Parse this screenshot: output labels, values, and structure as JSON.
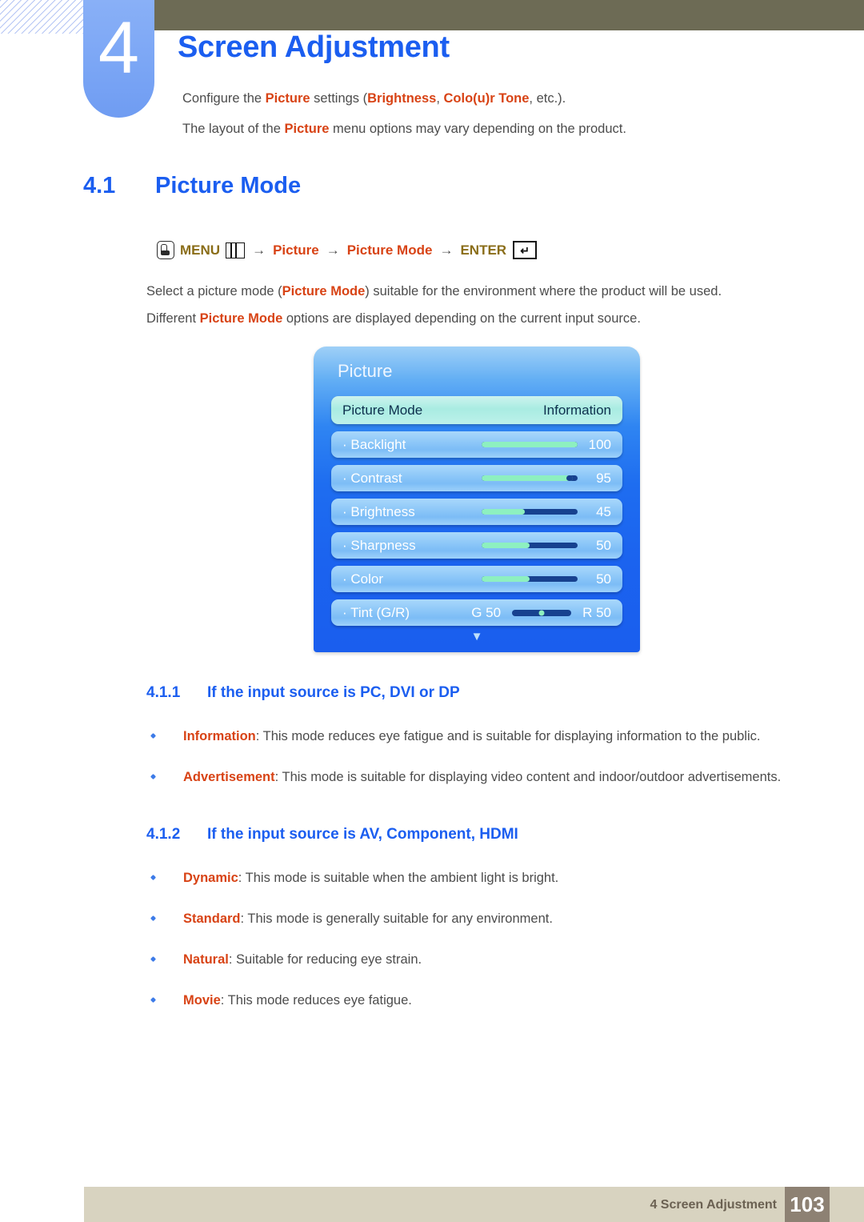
{
  "chapter": {
    "number": "4",
    "title": "Screen Adjustment",
    "lead_line1_pre": "Configure the ",
    "lead_line1_hl1": "Picture",
    "lead_line1_mid": " settings (",
    "lead_line1_hl2": "Brightness",
    "lead_line1_mid2": ", ",
    "lead_line1_hl3": "Colo(u)r Tone",
    "lead_line1_post": ", etc.).",
    "lead_line2_pre": "The layout of the ",
    "lead_line2_hl": "Picture",
    "lead_line2_post": " menu options may vary depending on the product."
  },
  "section": {
    "number": "4.1",
    "title": "Picture Mode"
  },
  "menu_path": {
    "hand_icon": "hand-press-icon",
    "menu_label": "MENU",
    "menu_icon": "menu-bars-icon",
    "arrow": "→",
    "step1": "Picture",
    "step2": "Picture Mode",
    "enter_label": "ENTER",
    "enter_icon": "enter-return-icon"
  },
  "paragraph": {
    "line1_pre": "Select a picture mode (",
    "line1_hl": "Picture Mode",
    "line1_post": ") suitable for the environment where the product will be used.",
    "line2_pre": "Different ",
    "line2_hl": "Picture Mode",
    "line2_post": " options are displayed depending on the current input source."
  },
  "osd": {
    "title": "Picture",
    "down_arrow": "▼",
    "rows": [
      {
        "label": "Picture Mode",
        "value": "Information",
        "selected": true,
        "slider": null
      },
      {
        "label": "· Backlight",
        "value": "100",
        "selected": false,
        "slider": {
          "percent": 100,
          "capped": false
        }
      },
      {
        "label": "· Contrast",
        "value": "95",
        "selected": false,
        "slider": {
          "percent": 95,
          "capped": true
        }
      },
      {
        "label": "· Brightness",
        "value": "45",
        "selected": false,
        "slider": {
          "percent": 45,
          "capped": false
        }
      },
      {
        "label": "· Sharpness",
        "value": "50",
        "selected": false,
        "slider": {
          "percent": 50,
          "capped": false
        }
      },
      {
        "label": "· Color",
        "value": "50",
        "selected": false,
        "slider": {
          "percent": 50,
          "capped": false
        }
      }
    ],
    "tint_row": {
      "label": "· Tint (G/R)",
      "left_value": "G 50",
      "right_value": "R 50"
    }
  },
  "subsection1": {
    "number": "4.1.1",
    "title": "If the input source is PC, DVI or DP",
    "items": [
      {
        "term": "Information",
        "text": ": This mode reduces eye fatigue and is suitable for displaying information to the public."
      },
      {
        "term": "Advertisement",
        "text": ": This mode is suitable for displaying video content and indoor/outdoor advertisements."
      }
    ]
  },
  "subsection2": {
    "number": "4.1.2",
    "title": "If the input source is AV, Component, HDMI",
    "items": [
      {
        "term": "Dynamic",
        "text": ": This mode is suitable when the ambient light is bright."
      },
      {
        "term": "Standard",
        "text": ": This mode is generally suitable for any environment."
      },
      {
        "term": "Natural",
        "text": ": Suitable for reducing eye strain."
      },
      {
        "term": "Movie",
        "text": ": This mode reduces eye fatigue."
      }
    ]
  },
  "footer": {
    "text": "4 Screen Adjustment",
    "page": "103"
  },
  "colors": {
    "heading_blue": "#1b5ef0",
    "highlight_red": "#d84315",
    "menu_gold": "#8a6d18",
    "olive_bar": "#6d6b55",
    "footer_bar": "#d8d3c0",
    "page_box": "#8d8173",
    "badge_blue": "#7ba6f5",
    "osd_blue": "#1e6df0",
    "osd_slider_fill": "#8df0c0"
  }
}
